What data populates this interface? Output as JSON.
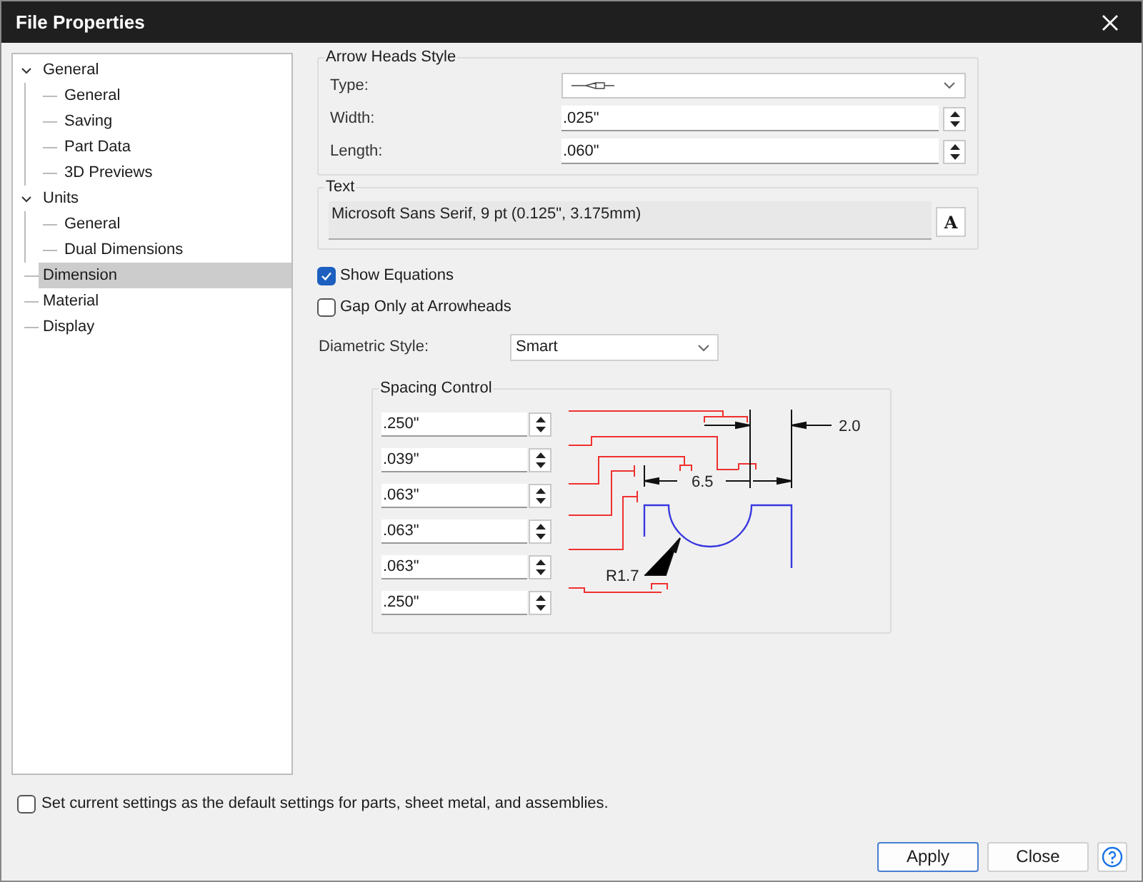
{
  "window": {
    "title": "File Properties"
  },
  "tree": [
    {
      "label": "General",
      "expanded": true,
      "selected": false,
      "children": [
        {
          "label": "General",
          "selected": false
        },
        {
          "label": "Saving",
          "selected": false
        },
        {
          "label": "Part Data",
          "selected": false
        },
        {
          "label": "3D Previews",
          "selected": false
        }
      ]
    },
    {
      "label": "Units",
      "expanded": true,
      "selected": false,
      "children": [
        {
          "label": "General",
          "selected": false
        },
        {
          "label": "Dual Dimensions",
          "selected": false
        }
      ]
    },
    {
      "label": "Dimension",
      "selected": true
    },
    {
      "label": "Material",
      "selected": false
    },
    {
      "label": "Display",
      "selected": false
    }
  ],
  "arrow_heads_style": {
    "title": "Arrow Heads Style",
    "fields": [
      {
        "label": "Type:",
        "kind": "dropdown"
      },
      {
        "label": "Width:",
        "kind": "spin",
        "value": ".025\""
      },
      {
        "label": "Length:",
        "kind": "spin",
        "value": ".060\""
      }
    ]
  },
  "text_group": {
    "title": "Text",
    "value": "Microsoft Sans Serif, 9 pt (0.125\", 3.175mm)",
    "button": "A"
  },
  "options": [
    {
      "label": "Show Equations",
      "checked": true
    },
    {
      "label": "Gap Only at Arrowheads",
      "checked": false
    }
  ],
  "diametric_style": {
    "label": "Diametric Style:",
    "value": "Smart"
  },
  "spacing_control": {
    "title": "Spacing Control",
    "values": [
      ".250\"",
      ".039\"",
      ".063\"",
      ".063\"",
      ".063\"",
      ".250\""
    ],
    "diagram_labels": [
      "2.0",
      "6.5",
      "R1.7"
    ]
  },
  "default_settings": {
    "label": "Set current settings as the default settings for parts, sheet metal, and assemblies.",
    "checked": false
  },
  "buttons": [
    {
      "label": "Apply",
      "default": true
    },
    {
      "label": "Close",
      "default": false
    }
  ]
}
